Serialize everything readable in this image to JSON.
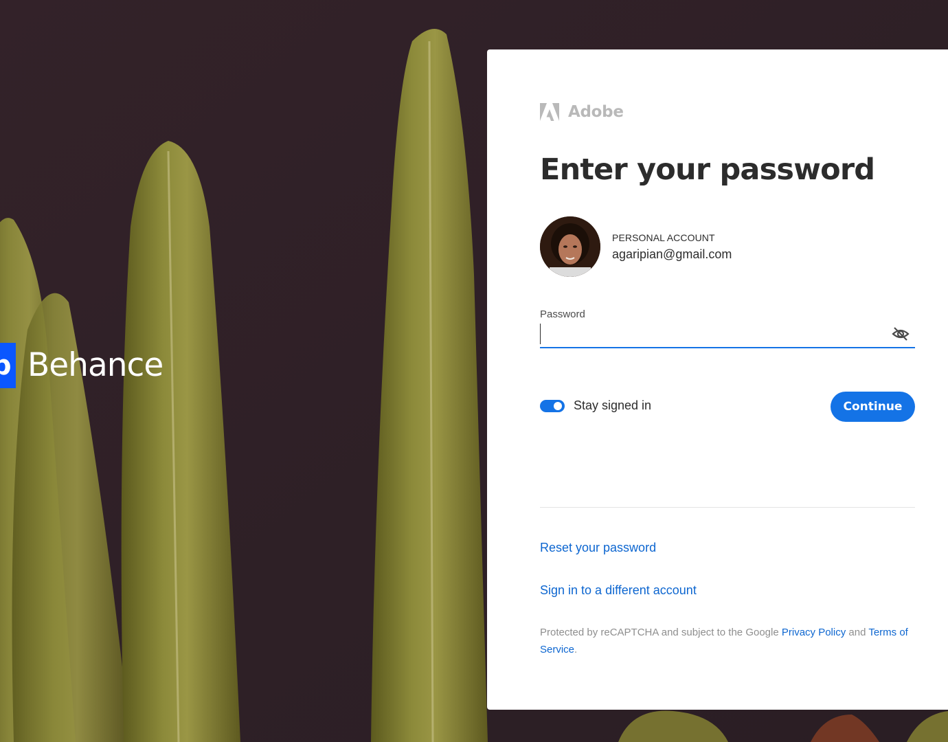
{
  "brand": {
    "logo_letter": "b",
    "name": "Behance"
  },
  "card": {
    "vendor_logo_text": "Adobe",
    "title": "Enter your password",
    "account": {
      "type": "PERSONAL ACCOUNT",
      "email": "agaripian@gmail.com"
    },
    "password": {
      "label": "Password",
      "value": "",
      "visibility_icon": "eye-off-icon"
    },
    "stay_signed_in": {
      "label": "Stay signed in",
      "checked": true
    },
    "continue_label": "Continue",
    "links": {
      "reset_password": "Reset your password",
      "different_account": "Sign in to a different account"
    },
    "legal": {
      "prefix": "Protected by reCAPTCHA and subject to the Google ",
      "privacy_link": "Privacy Policy",
      "middle": " and ",
      "terms_link": "Terms of Service",
      "suffix": "."
    }
  },
  "colors": {
    "accent": "#1473e6",
    "link": "#0d66d0",
    "behance_blue": "#0b57ff",
    "background": "#2f2126"
  }
}
